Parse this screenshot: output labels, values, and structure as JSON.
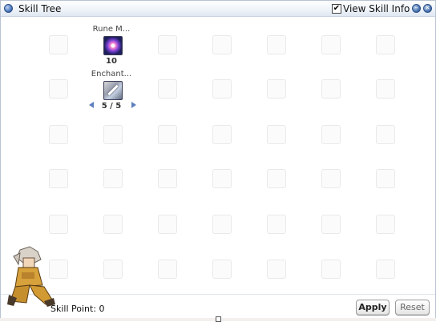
{
  "window": {
    "title": "Skill Tree",
    "view_skill_info_label": "View Skill Info",
    "view_skill_info_checked": true,
    "minimize_symbol": "–",
    "close_symbol": "×"
  },
  "skills": [
    {
      "name": "Rune M...",
      "level": "10",
      "icon": "rune-mastery-icon"
    },
    {
      "name": "Enchant...",
      "level": "5 / 5",
      "icon": "enchant-blade-icon"
    }
  ],
  "footer": {
    "skill_point_label": "Skill Point:",
    "skill_point_value": "0",
    "apply_label": "Apply",
    "reset_label": "Reset"
  },
  "colors": {
    "title_gradient_end": "#dfe7f1",
    "border": "#b9c3d2",
    "arrow": "#5d7fc0"
  }
}
